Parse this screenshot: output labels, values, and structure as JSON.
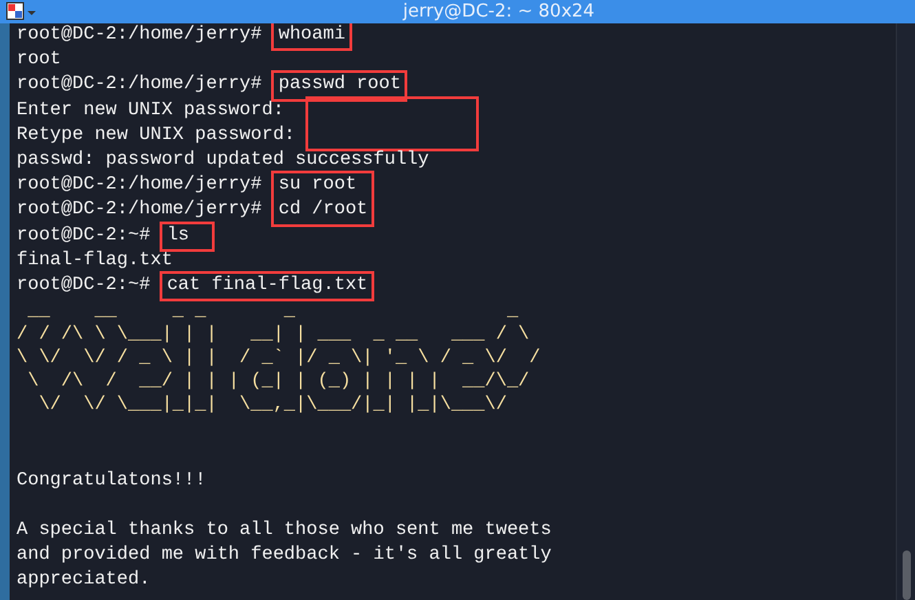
{
  "window": {
    "title": "jerry@DC-2: ~ 80x24"
  },
  "terminal": {
    "lines": [
      {
        "kind": "highlighted",
        "lines": [
          {
            "kind": "command",
            "prompt": "root@DC-2:/home/jerry#",
            "command": "whoami"
          }
        ]
      },
      {
        "kind": "output",
        "text": "root"
      },
      {
        "kind": "highlighted",
        "lines": [
          {
            "kind": "command",
            "prompt": "root@DC-2:/home/jerry#",
            "command": "passwd root"
          }
        ]
      },
      {
        "kind": "highlighted",
        "lines": [
          {
            "kind": "password",
            "prompt": "Enter new UNIX password:"
          },
          {
            "kind": "password",
            "prompt": "Retype new UNIX password:"
          }
        ]
      },
      {
        "kind": "output",
        "text": "passwd: password updated successfully"
      },
      {
        "kind": "highlighted",
        "lines": [
          {
            "kind": "command",
            "prompt": "root@DC-2:/home/jerry#",
            "command": "su root"
          },
          {
            "kind": "command",
            "prompt": "root@DC-2:/home/jerry#",
            "command": "cd /root"
          }
        ]
      },
      {
        "kind": "highlighted",
        "lines": [
          {
            "kind": "command",
            "prompt": "root@DC-2:~#",
            "command": "ls"
          }
        ]
      },
      {
        "kind": "output",
        "text": "final-flag.txt"
      },
      {
        "kind": "highlighted",
        "lines": [
          {
            "kind": "command",
            "prompt": "root@DC-2:~#",
            "command": "cat final-flag.txt"
          }
        ]
      },
      {
        "kind": "art",
        "text": " __    __     _ _       _                   _ \n/ / /\\ \\ \\___| | |   __| | ___  _ __   ___ / \\\n\\ \\/  \\/ / _ \\ | |  / _` |/ _ \\| '_ \\ / _ \\/  /\n \\  /\\  /  __/ | | | (_| | (_) | | | |  __/\\_/ \n  \\/  \\/ \\___|_|_|  \\__,_|\\___/|_| |_|\\___\\/   "
      },
      {
        "kind": "blank"
      },
      {
        "kind": "blank"
      },
      {
        "kind": "output",
        "text": "Congratulatons!!!"
      },
      {
        "kind": "blank"
      },
      {
        "kind": "output",
        "text": "A special thanks to all those who sent me tweets\nand provided me with feedback - it's all greatly\nappreciated."
      }
    ]
  }
}
